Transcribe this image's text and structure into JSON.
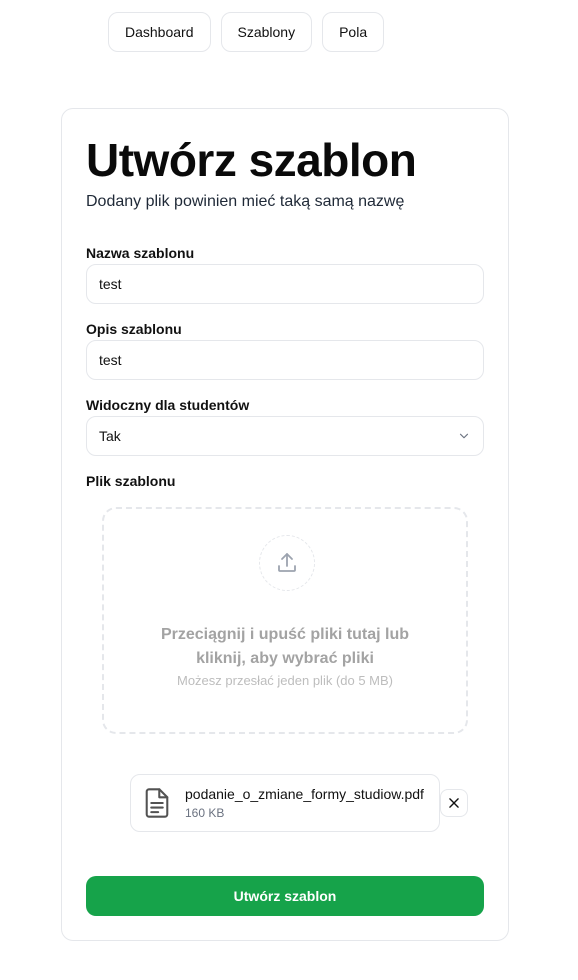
{
  "nav": {
    "items": [
      {
        "label": "Dashboard"
      },
      {
        "label": "Szablony"
      },
      {
        "label": "Pola"
      }
    ]
  },
  "form": {
    "title": "Utwórz szablon",
    "subtitle": "Dodany plik powinien mieć taką samą nazwę",
    "name_label": "Nazwa szablonu",
    "name_value": "test",
    "description_label": "Opis szablonu",
    "description_value": "test",
    "visible_label": "Widoczny dla studentów",
    "visible_value": "Tak",
    "file_label": "Plik szablonu",
    "dropzone_text": "Przeciągnij i upuść pliki tutaj lub kliknij, aby wybrać pliki",
    "dropzone_hint": "Możesz przesłać jeden plik (do 5 MB)",
    "uploaded_file": {
      "name": "podanie_o_zmiane_formy_studiow.pdf",
      "size": "160 KB"
    },
    "submit_label": "Utwórz szablon"
  },
  "icons": {
    "upload": "upload-icon",
    "file": "file-text-icon",
    "close": "close-icon",
    "chevron": "chevron-down-icon"
  },
  "colors": {
    "primary": "#16a34a",
    "border": "#e5e7eb",
    "muted_text": "#a3a3a3"
  }
}
